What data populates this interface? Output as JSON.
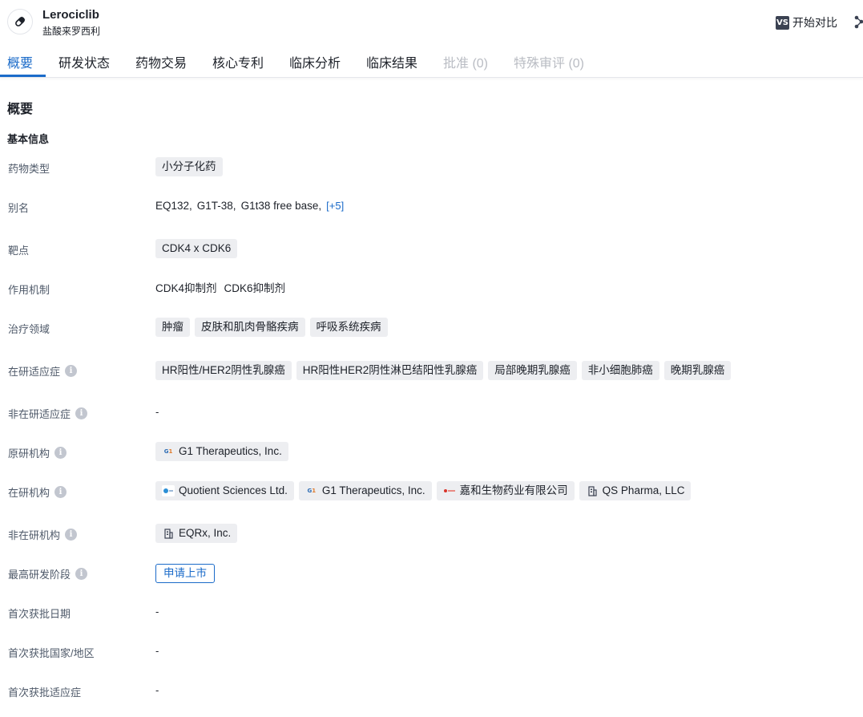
{
  "header": {
    "drug_name": "Lerociclib",
    "drug_subtitle": "盐酸来罗西利",
    "compare_badge": "VS",
    "compare_label": "开始对比"
  },
  "tabs": [
    {
      "label": "概要",
      "state": "active"
    },
    {
      "label": "研发状态",
      "state": "normal"
    },
    {
      "label": "药物交易",
      "state": "normal"
    },
    {
      "label": "核心专利",
      "state": "normal"
    },
    {
      "label": "临床分析",
      "state": "normal"
    },
    {
      "label": "临床结果",
      "state": "normal"
    },
    {
      "label": "批准 (0)",
      "state": "disabled"
    },
    {
      "label": "特殊审评 (0)",
      "state": "disabled"
    }
  ],
  "overview": {
    "section_title": "概要",
    "basic_info_title": "基本信息",
    "rows": {
      "drug_type": {
        "label": "药物类型",
        "tags": [
          "小分子化药"
        ]
      },
      "aliases": {
        "label": "别名",
        "values": [
          "EQ132,",
          "G1T-38,",
          "G1t38 free base,"
        ],
        "more": "[+5]"
      },
      "target": {
        "label": "靶点",
        "tags": [
          "CDK4 x CDK6"
        ]
      },
      "mechanism": {
        "label": "作用机制",
        "values": [
          "CDK4抑制剂",
          "CDK6抑制剂"
        ]
      },
      "therapeutic_area": {
        "label": "治疗领域",
        "tags": [
          "肿瘤",
          "皮肤和肌肉骨骼疾病",
          "呼吸系统疾病"
        ]
      },
      "active_indications": {
        "label": "在研适应症",
        "tags": [
          "HR阳性/HER2阴性乳腺癌",
          "HR阳性HER2阴性淋巴结阳性乳腺癌",
          "局部晚期乳腺癌",
          "非小细胞肺癌",
          "晚期乳腺癌"
        ]
      },
      "inactive_indications": {
        "label": "非在研适应症",
        "value": "-"
      },
      "originator": {
        "label": "原研机构",
        "orgs": [
          {
            "name": "G1 Therapeutics, Inc.",
            "logo": "G1"
          }
        ]
      },
      "active_orgs": {
        "label": "在研机构",
        "orgs": [
          {
            "name": "Quotient Sciences Ltd.",
            "logo": "quotient-logo"
          },
          {
            "name": "G1 Therapeutics, Inc.",
            "logo": "G1"
          },
          {
            "name": "嘉和生物药业有限公司",
            "logo": "genor-logo"
          },
          {
            "name": "QS Pharma, LLC",
            "logo": "building-icon"
          }
        ]
      },
      "inactive_orgs": {
        "label": "非在研机构",
        "orgs": [
          {
            "name": "EQRx, Inc.",
            "logo": "building-icon"
          }
        ]
      },
      "highest_phase": {
        "label": "最高研发阶段",
        "tag": "申请上市"
      },
      "first_approval_date": {
        "label": "首次获批日期",
        "value": "-"
      },
      "first_approval_country": {
        "label": "首次获批国家/地区",
        "value": "-"
      },
      "first_approval_indication": {
        "label": "首次获批适应症",
        "value": "-"
      }
    }
  },
  "colors": {
    "accent": "#1b6bc9",
    "tag_bg": "#edeef1",
    "muted": "#b9bcc3"
  }
}
